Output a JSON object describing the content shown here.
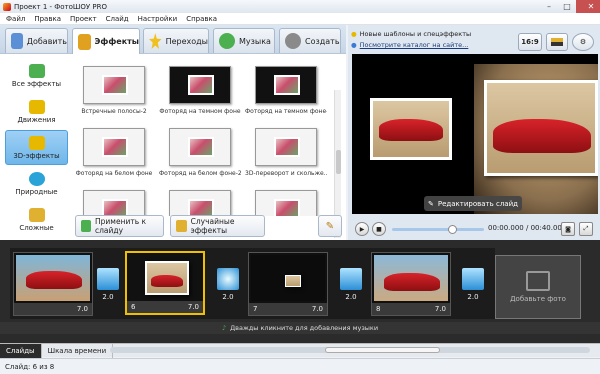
{
  "window": {
    "title": "Проект 1 - ФотоШОУ PRO",
    "min": "–",
    "max": "□",
    "close": "✕"
  },
  "menu": [
    "Файл",
    "Правка",
    "Проект",
    "Слайд",
    "Настройки",
    "Справка"
  ],
  "tabs": [
    {
      "label": "Добавить",
      "icon": "add-photo-icon",
      "color": "#5b8fd6"
    },
    {
      "label": "Эффекты",
      "icon": "effects-icon",
      "color": "#e0a020"
    },
    {
      "label": "Переходы",
      "icon": "star-icon",
      "color": "#f0c020"
    },
    {
      "label": "Музыка",
      "icon": "music-icon",
      "color": "#4caf50"
    },
    {
      "label": "Создать",
      "icon": "film-reel-icon",
      "color": "#8a8a8a"
    }
  ],
  "effect_categories": [
    {
      "label": "Все эффекты",
      "color": "#4caf50"
    },
    {
      "label": "Движения",
      "color": "#e6b800"
    },
    {
      "label": "3D-эффекты",
      "color": "#e6b800"
    },
    {
      "label": "Природные",
      "color": "#29a3d8"
    },
    {
      "label": "Сложные",
      "color": "#e0b030"
    }
  ],
  "effects": [
    {
      "caption": "Встречные полосы-2",
      "style": "light"
    },
    {
      "caption": "Фоторяд на темном фоне",
      "style": "dark"
    },
    {
      "caption": "Фоторяд на темном фоне-2",
      "style": "dark"
    },
    {
      "caption": "Фоторяд на белом фоне",
      "style": "light"
    },
    {
      "caption": "Фоторяд на белом фоне-2",
      "style": "light"
    },
    {
      "caption": "3D-переворот и скольже...",
      "style": "light"
    },
    {
      "caption": "",
      "style": "light"
    },
    {
      "caption": "",
      "style": "light"
    },
    {
      "caption": "",
      "style": "light"
    }
  ],
  "actions": {
    "apply": "Применить к слайду",
    "random": "Случайные эффекты"
  },
  "promo": {
    "new_templates": "Новые шаблоны и спецэффекты",
    "catalog_link": "Посмотрите каталог на сайте..."
  },
  "aspect": "16:9",
  "preview": {
    "edit_slide": "Редактировать слайд",
    "time": "00:00.000 / 00:40.000"
  },
  "timeline": {
    "slides": [
      {
        "number": "",
        "duration": "7.0"
      },
      {
        "number": "6",
        "duration": "7.0"
      },
      {
        "number": "7",
        "duration": "7.0"
      },
      {
        "number": "8",
        "duration": "7.0"
      }
    ],
    "transitions": [
      "2.0",
      "2.0",
      "2.0",
      "2.0"
    ],
    "add_photo": "Добавьте фото",
    "music_hint": "Дважды кликните для добавления музыки"
  },
  "bottom_tabs": [
    "Слайды",
    "Шкала времени"
  ],
  "status": "Слайд: 6 из 8"
}
